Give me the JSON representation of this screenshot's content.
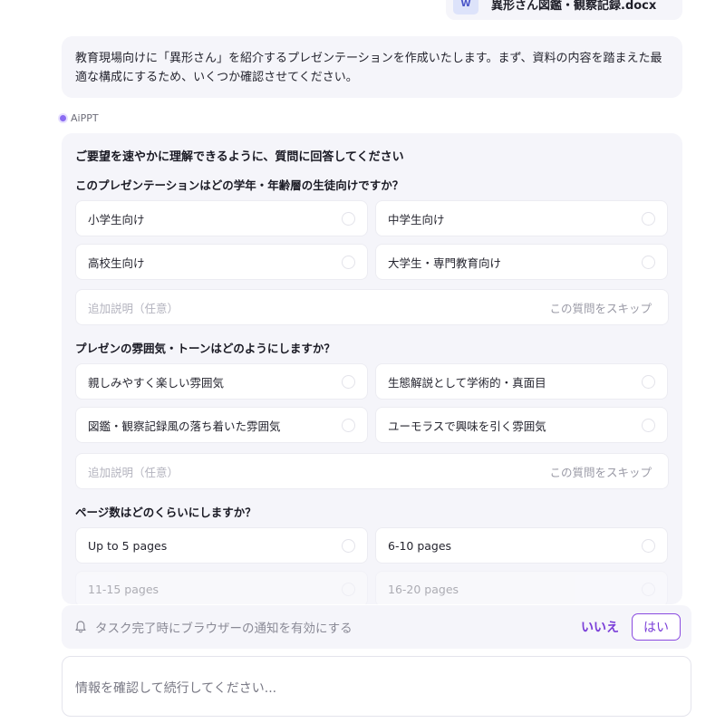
{
  "user_message": {
    "file_icon_label": "W",
    "file_name": "異形さん図鑑・観察記録.docx"
  },
  "ai_message": "教育現場向けに「異形さん」を紹介するプレゼンテーションを作成いたします。まず、資料の内容を踏まえた最適な構成にするため、いくつか確認させてください。",
  "agent": {
    "name": "AiPPT"
  },
  "questionnaire": {
    "intro": "ご要望を速やかに理解できるように、質問に回答してください",
    "questions": [
      {
        "title": "このプレゼンテーションはどの学年・年齢層の生徒向けですか？",
        "options": [
          "小学生向け",
          "中学生向け",
          "高校生向け",
          "大学生・専門教育向け"
        ],
        "extra_placeholder": "追加説明（任意）",
        "skip_label": "この質問をスキップ"
      },
      {
        "title": "プレゼンの雰囲気・トーンはどのようにしますか？",
        "options": [
          "親しみやすく楽しい雰囲気",
          "生態解説として学術的・真面目",
          "図鑑・観察記録風の落ち着いた雰囲気",
          "ユーモラスで興味を引く雰囲気"
        ],
        "extra_placeholder": "追加説明（任意）",
        "skip_label": "この質問をスキップ"
      },
      {
        "title": "ページ数はどのくらいにしますか？",
        "options": [
          "Up to 5 pages",
          "6-10 pages",
          "11-15 pages",
          "16-20 pages"
        ]
      }
    ]
  },
  "notification": {
    "text": "タスク完了時にブラウザーの通知を有効にする",
    "no_label": "いいえ",
    "yes_label": "はい",
    "bell_icon": "bell-icon"
  },
  "composer": {
    "placeholder": "情報を確認して続行してください..."
  }
}
